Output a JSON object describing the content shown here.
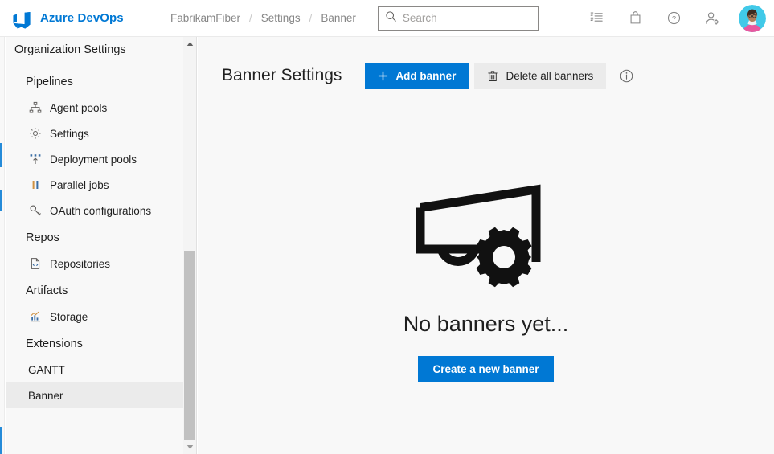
{
  "topbar": {
    "brand": "Azure DevOps",
    "logo_icon": "azure-devops-logo",
    "breadcrumb": [
      {
        "label": "FabrikamFiber"
      },
      {
        "label": "Settings"
      },
      {
        "label": "Banner"
      }
    ],
    "breadcrumb_separator": "/",
    "search": {
      "placeholder": "Search",
      "value": "",
      "icon": "search-icon"
    },
    "icons": [
      {
        "name": "tasks-icon",
        "title": "Tasks"
      },
      {
        "name": "marketplace-bag-icon",
        "title": "Marketplace"
      },
      {
        "name": "help-question-icon",
        "title": "Help"
      },
      {
        "name": "user-settings-icon",
        "title": "User settings"
      }
    ],
    "avatar": {
      "name": "user-avatar",
      "title": "Account manager"
    }
  },
  "sidebar": {
    "header": "Organization Settings",
    "items": [
      {
        "label": "Pipelines",
        "type": "group"
      },
      {
        "label": "Agent pools",
        "type": "item",
        "icon": "sitemap-icon"
      },
      {
        "label": "Settings",
        "type": "item",
        "icon": "gear-icon"
      },
      {
        "label": "Deployment pools",
        "type": "item",
        "icon": "deployment-pool-icon"
      },
      {
        "label": "Parallel jobs",
        "type": "item",
        "icon": "parallel-bars-icon"
      },
      {
        "label": "OAuth configurations",
        "type": "item",
        "icon": "key-icon"
      },
      {
        "label": "Repos",
        "type": "group"
      },
      {
        "label": "Repositories",
        "type": "item",
        "icon": "repository-file-icon"
      },
      {
        "label": "Artifacts",
        "type": "group"
      },
      {
        "label": "Storage",
        "type": "item",
        "icon": "storage-chart-icon"
      },
      {
        "label": "Extensions",
        "type": "group"
      },
      {
        "label": "GANTT",
        "type": "item",
        "icon": ""
      },
      {
        "label": "Banner",
        "type": "item",
        "icon": "",
        "selected": true
      }
    ],
    "scrollbar": {
      "up_arrow": "scroll-up-arrow",
      "down_arrow": "scroll-down-arrow"
    }
  },
  "main": {
    "title": "Banner Settings",
    "add_banner_label": "Add banner",
    "add_banner_icon": "plus-icon",
    "delete_all_label": "Delete all banners",
    "delete_all_icon": "trash-icon",
    "info_icon": "info-circle-icon",
    "empty_state": {
      "illustration": "banner-megaphone-gear-illustration",
      "title": "No banners yet...",
      "cta_label": "Create a new banner"
    }
  },
  "colors": {
    "accent": "#0078d4",
    "topbar_bg": "#ffffff",
    "sidebar_bg": "#f8f8f8",
    "content_bg": "#f8f8f8",
    "secondary_button_bg": "#ebebeb",
    "selected_nav_bg": "#ebebeb",
    "text_primary": "#1f1f1f",
    "text_muted": "#868686",
    "avatar_ring": "#41c9e8"
  }
}
